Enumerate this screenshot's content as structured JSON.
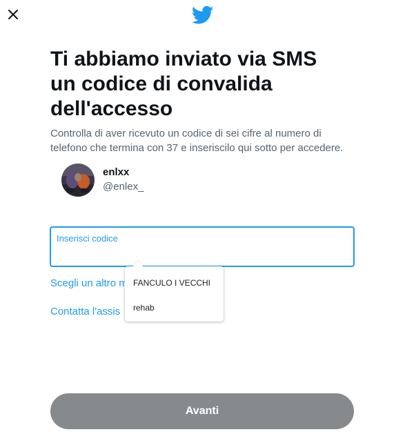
{
  "header": {
    "close_icon": "close-icon",
    "logo_icon": "twitter-bird-icon",
    "brand_color": "#1d9bf0"
  },
  "main": {
    "title_line1": "Ti abbiamo inviato via SMS",
    "title_line2": "un codice di convalida",
    "title_line3": "dell'accesso",
    "subtitle_line1": "Controlla di aver ricevuto un codice di sei cifre al numero di",
    "subtitle_line2": "telefono che termina con 37 e inseriscilo qui sotto per accedere."
  },
  "user": {
    "name": "enlxx",
    "handle": "@enlex_"
  },
  "code_field": {
    "label": "Inserisci codice",
    "value": ""
  },
  "links": {
    "other_method": "Scegli un altro m",
    "help": "Contatta l'assis"
  },
  "autocomplete": {
    "options": [
      "FANCULO I VECCHI",
      "rehab"
    ]
  },
  "footer": {
    "next_label": "Avanti"
  }
}
